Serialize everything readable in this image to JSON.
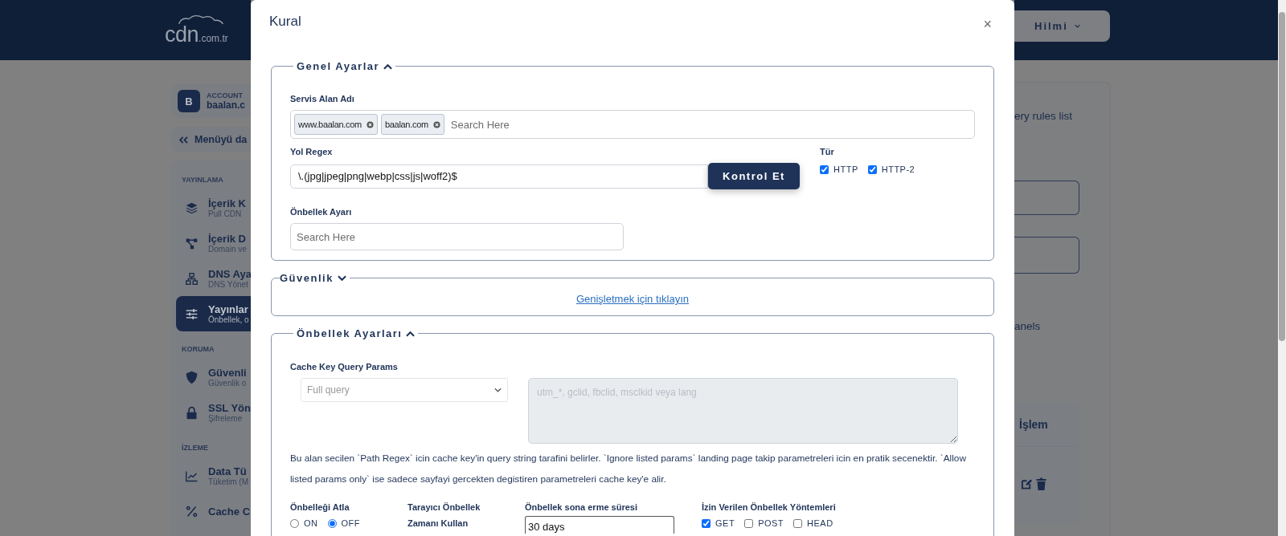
{
  "header": {
    "logo_main": "cdn",
    "logo_suffix": ".com.tr",
    "user": "Hilmi"
  },
  "sidebar": {
    "account_initial": "B",
    "account_label": "ACCOUNT",
    "account_name": "baalan.c",
    "collapse": "Menüyü da",
    "sections": [
      {
        "title": "YAYINLAMA",
        "items": [
          {
            "title": "İçerik K",
            "subtitle": "Pull CDN",
            "selected": false
          },
          {
            "title": "İçerik D",
            "subtitle": "Domain ve",
            "selected": false
          },
          {
            "title": "DNS Aya",
            "subtitle": "DNS Yönet",
            "selected": false
          },
          {
            "title": "Yayınlar",
            "subtitle": "Önbellek, o",
            "selected": true
          }
        ]
      },
      {
        "title": "KORUMA",
        "items": [
          {
            "title": "Güvenli",
            "subtitle": "Güvenlik o",
            "selected": false
          },
          {
            "title": "SSL Yön",
            "subtitle": "Şifreleme",
            "selected": false
          }
        ]
      },
      {
        "title": "İZLEME",
        "items": [
          {
            "title": "Data Tü",
            "subtitle": "Tüketim (M",
            "selected": false
          },
          {
            "title": "Cache C",
            "selected": false
          }
        ]
      }
    ]
  },
  "background": {
    "text_1": "ery rules list",
    "text_2": "anels",
    "table_header": "İşlem"
  },
  "modal": {
    "title": "Kural",
    "close": "×",
    "general": {
      "title": "Genel Ayarlar",
      "expanded": true,
      "domain": {
        "label": "Servis Alan Adı",
        "tags": [
          "www.baalan.com",
          "baalan.com"
        ],
        "placeholder": "Search Here"
      },
      "regex": {
        "label": "Yol Regex",
        "value": "\\.(jpg|jpeg|png|webp|css|js|woff2)$",
        "button": "Kontrol Et"
      },
      "type": {
        "label": "Tür",
        "options": [
          {
            "label": "HTTP",
            "checked": true
          },
          {
            "label": "HTTP-2",
            "checked": true
          }
        ]
      },
      "cache_setting": {
        "label": "Önbellek Ayarı",
        "placeholder": "Search Here"
      }
    },
    "security": {
      "title": "Güvenlik",
      "expanded": false,
      "expand_link": "Genişletmek için tıklayın"
    },
    "cache": {
      "title": "Önbellek Ayarları",
      "expanded": true,
      "query_params": {
        "label": "Cache Key Query Params",
        "select": "Full query",
        "disabled": true,
        "textarea_placeholder": "utm_*, gclid, fbclid, msclkid veya lang"
      },
      "help": "Bu alan secilen `Path Regex` icin cache key'in query string tarafini belirler. `Ignore listed params` landing page takip parametreleri icin en pratik secenektir. `Allow listed params only` ise sadece sayfayi gercekten degistiren parametreleri cache key'e alir.",
      "bypass": {
        "label": "Önbelleği Atla",
        "options": [
          {
            "label": "ON",
            "selected": false
          },
          {
            "label": "OFF",
            "selected": true
          }
        ]
      },
      "browser_ttl": {
        "label": "Tarayıcı Önbellek Zamanı Kullan"
      },
      "expiry": {
        "label": "Önbellek sona erme süresi",
        "value": "30 days"
      },
      "methods": {
        "label": "İzin Verilen Önbellek Yöntemleri",
        "options": [
          {
            "label": "GET",
            "checked": true
          },
          {
            "label": "POST",
            "checked": false
          },
          {
            "label": "HEAD",
            "checked": false
          }
        ]
      }
    }
  }
}
